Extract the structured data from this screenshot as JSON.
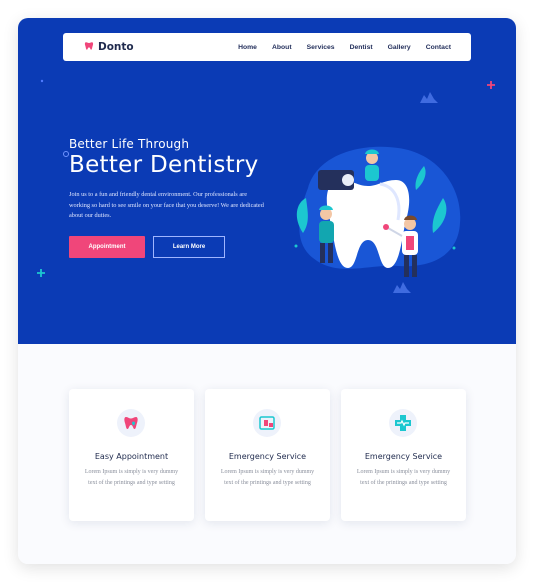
{
  "brand": {
    "name": "Donto",
    "logo_icon": "tooth-icon"
  },
  "nav": {
    "links": [
      "Home",
      "About",
      "Services",
      "Dentist",
      "Gallery",
      "Contact"
    ]
  },
  "hero": {
    "title_small": "Better Life Through",
    "title_big": "Better Dentistry",
    "description": "Join us to a fun and friendly dental environment. Our professionals are working so hard to see smile on your face that you deserve! We are dedicated about our duties.",
    "primary_button": "Appointment",
    "secondary_button": "Learn More",
    "illustration": "dentists-with-tooth-illustration"
  },
  "services": [
    {
      "title": "Easy Appointment",
      "description": "Lorem Ipsum is simply is very dummy text of the printings and type setting",
      "icon": "tooth-heart-icon"
    },
    {
      "title": "Emergency Service",
      "description": "Lorem Ipsum is simply is very dummy text of the printings and type setting",
      "icon": "dental-chair-icon"
    },
    {
      "title": "Emergency Service",
      "description": "Lorem Ipsum is simply is very dummy text of the printings and type setting",
      "icon": "medical-cross-icon"
    }
  ],
  "colors": {
    "hero_bg": "#0b3bb5",
    "accent_pink": "#f0467a",
    "accent_cyan": "#1cc7d0",
    "text_dark": "#1f2a4d"
  }
}
